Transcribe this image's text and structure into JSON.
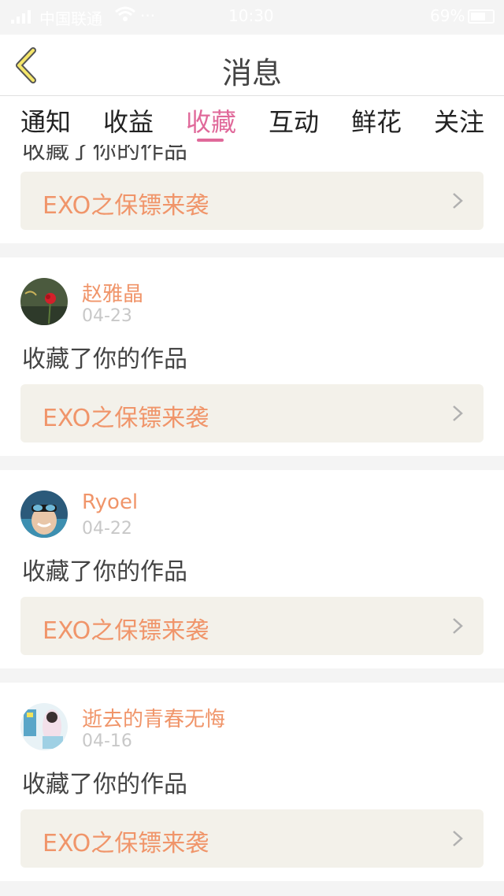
{
  "status_bar": {
    "carrier": "中国联通",
    "dots": "···",
    "time": "10:30",
    "battery": "69%"
  },
  "header": {
    "title": "消息"
  },
  "tabs": [
    {
      "label": "通知",
      "active": false
    },
    {
      "label": "收益",
      "active": false
    },
    {
      "label": "收藏",
      "active": true
    },
    {
      "label": "互动",
      "active": false
    },
    {
      "label": "鲜花",
      "active": false
    },
    {
      "label": "关注",
      "active": false
    }
  ],
  "accent_color": "#e0699a",
  "name_color": "#f0956a",
  "partial_item": {
    "action": "收藏了你的作品",
    "work_title": "EXO之保镖来袭"
  },
  "items": [
    {
      "username": "赵雅晶",
      "date": "04-23",
      "action": "收藏了你的作品",
      "work_title": "EXO之保镖来袭"
    },
    {
      "username": "Ryoel",
      "date": "04-22",
      "action": "收藏了你的作品",
      "work_title": "EXO之保镖来袭"
    },
    {
      "username": "逝去的青春无悔",
      "date": "04-16",
      "action": "收藏了你的作品",
      "work_title": "EXO之保镖来袭"
    }
  ]
}
